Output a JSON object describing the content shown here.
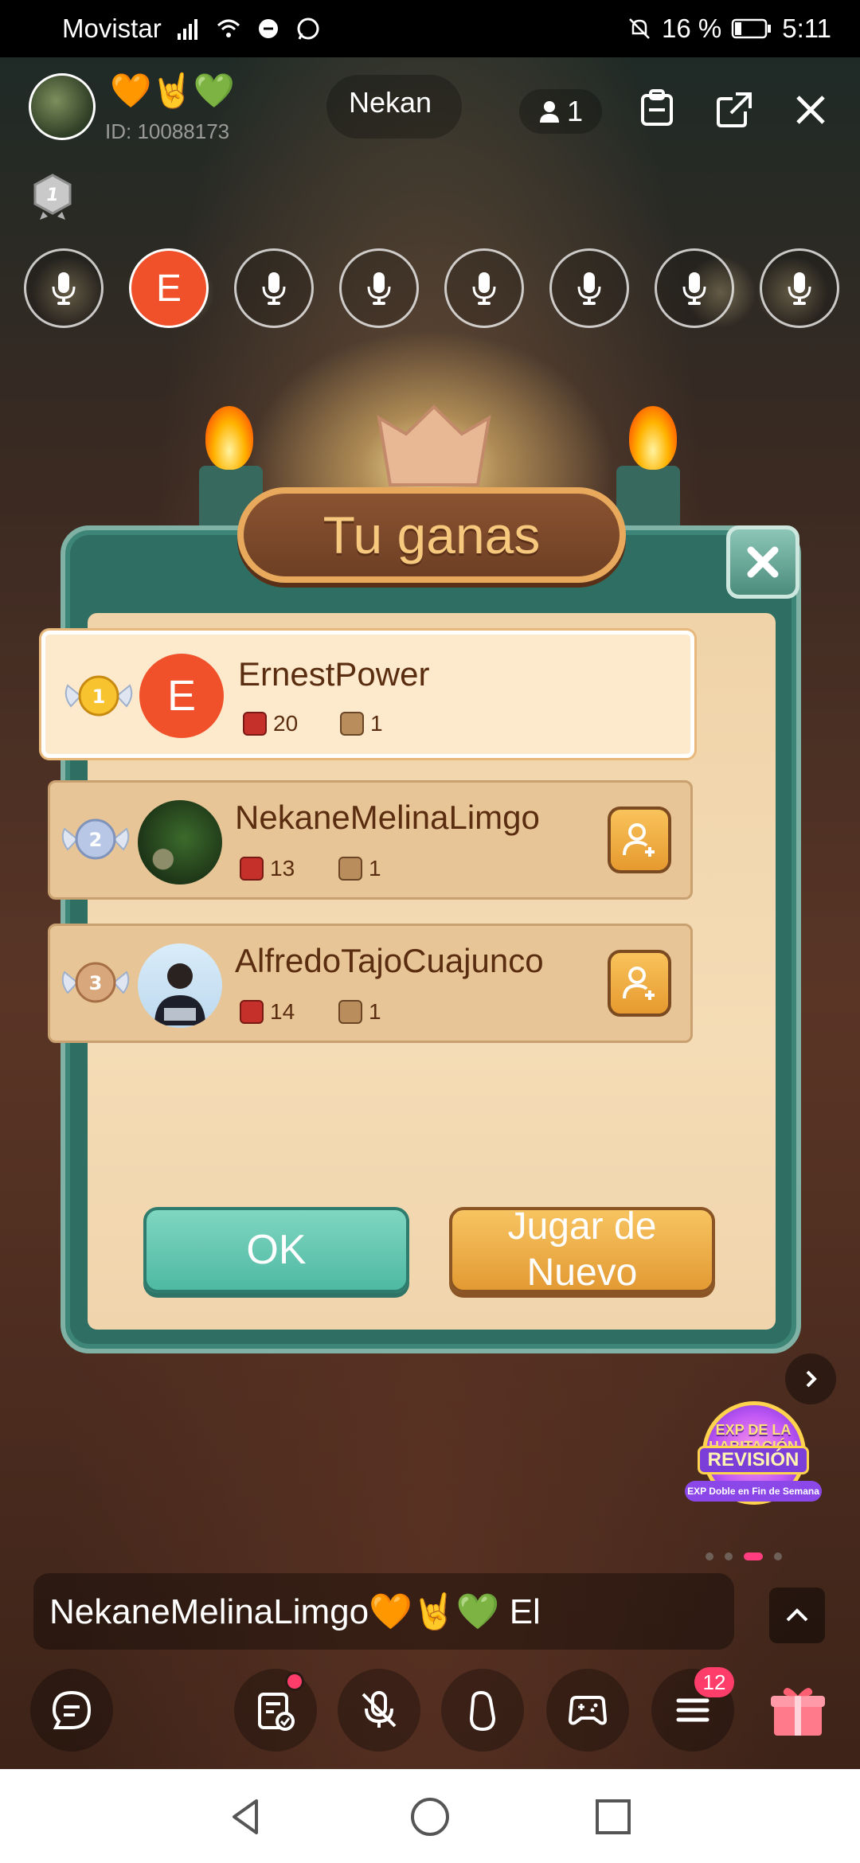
{
  "status_bar": {
    "carrier": "Movistar",
    "battery": "16 %",
    "time": "5:11"
  },
  "room": {
    "emojis": "🧡🤘💚",
    "id": "ID: 10088173",
    "name": "Nekan",
    "people_count": "1"
  },
  "seats": {
    "user_initial": "E"
  },
  "dialog": {
    "title": "Tu ganas",
    "players": [
      {
        "rank": "1",
        "initial": "E",
        "name": "ErnestPower",
        "dice": "20",
        "tool": "1"
      },
      {
        "rank": "2",
        "name": "NekaneMelinaLimgo",
        "dice": "13",
        "tool": "1"
      },
      {
        "rank": "3",
        "name": "AlfredoTajoCuajunco",
        "dice": "14",
        "tool": "1"
      }
    ],
    "ok_label": "OK",
    "again_label": "Jugar de Nuevo"
  },
  "promo": {
    "top": "EXP DE LA HABITACIÓN",
    "mid": "REVISIÓN",
    "bottom": "EXP Doble en Fin de Semana"
  },
  "chat": {
    "line": "NekaneMelinaLimgo🧡🤘💚  El"
  },
  "toolbar": {
    "menu_badge": "12"
  },
  "colors": {
    "accent_red": "#f0512a",
    "teal": "#4fb9a2",
    "orange": "#e39a33",
    "badge_pink": "#ff3d6a"
  }
}
